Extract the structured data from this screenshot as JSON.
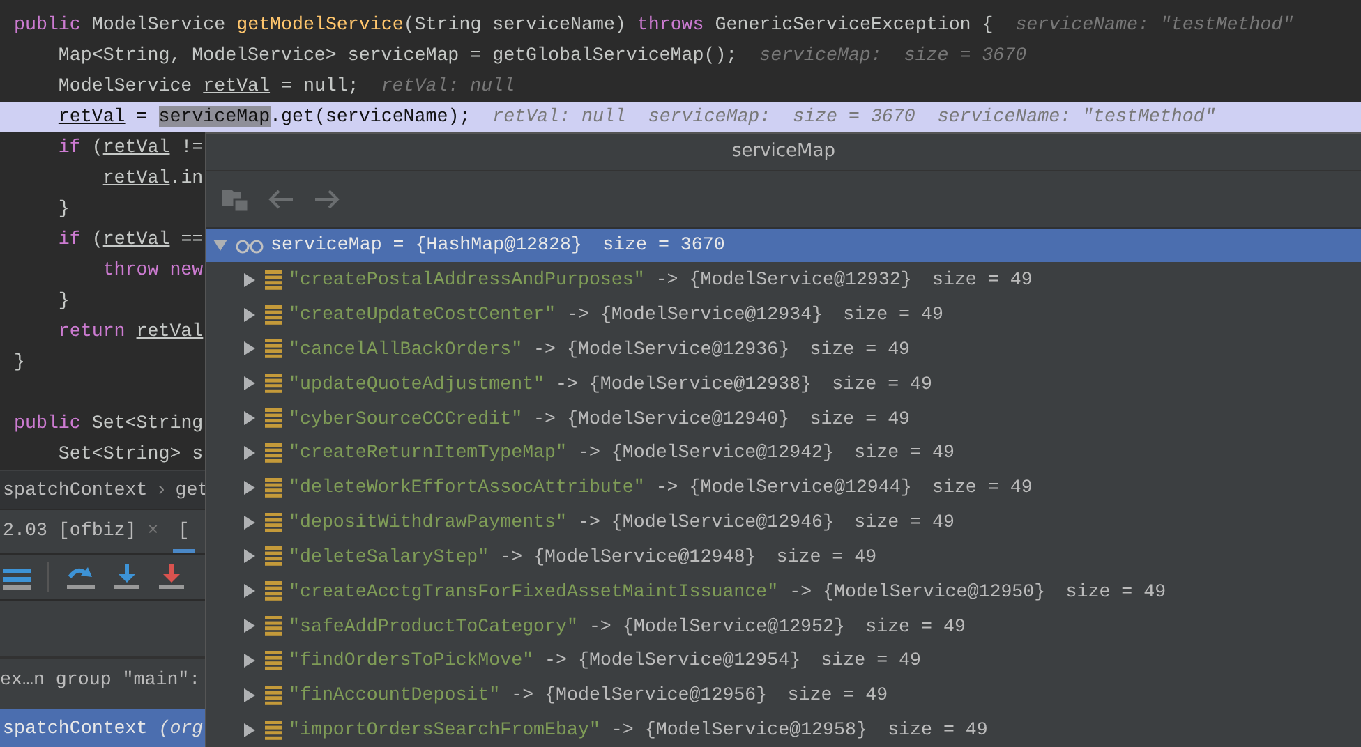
{
  "editor": {
    "lines": [
      {
        "kind": "code",
        "current": false,
        "tokens": [
          {
            "text": "public",
            "kind": "keyword"
          },
          {
            "text": " ModelService ",
            "kind": "plain"
          },
          {
            "text": "getModelService",
            "kind": "method"
          },
          {
            "text": "(String serviceName) ",
            "kind": "plain"
          },
          {
            "text": "throws",
            "kind": "keyword"
          },
          {
            "text": " GenericServiceException {",
            "kind": "plain"
          }
        ],
        "hint": "serviceName: \"testMethod\"",
        "children": [
          {
            "kind": "code",
            "current": false,
            "tokens": [
              {
                "text": "Map<String, ModelService> serviceMap = getGlobalServiceMap();",
                "kind": "plain"
              }
            ],
            "hint": "serviceMap:  size = 3670"
          },
          {
            "kind": "code",
            "current": false,
            "tokens": [
              {
                "text": "ModelService ",
                "kind": "plain"
              },
              {
                "text": "retVal",
                "kind": "variable"
              },
              {
                "text": " = null;",
                "kind": "plain"
              }
            ],
            "hint": "retVal: null"
          },
          {
            "kind": "code",
            "current": true,
            "tokens": [
              {
                "text": "retVal",
                "kind": "variable"
              },
              {
                "text": " = ",
                "kind": "plain"
              },
              {
                "text": "serviceMap",
                "kind": "selection"
              },
              {
                "text": ".get(serviceName);",
                "kind": "plain"
              }
            ],
            "hint": "retVal: null  serviceMap:  size = 3670  serviceName: \"testMethod\""
          },
          {
            "kind": "code",
            "current": false,
            "tokens": [
              {
                "text": "if",
                "kind": "keyword"
              },
              {
                "text": " (",
                "kind": "plain"
              },
              {
                "text": "retVal",
                "kind": "variable"
              },
              {
                "text": " !=",
                "kind": "plain"
              }
            ],
            "children": [
              {
                "kind": "code",
                "current": false,
                "tokens": [
                  {
                    "text": "retVal",
                    "kind": "variable"
                  },
                  {
                    "text": ".in",
                    "kind": "plain"
                  }
                ]
              }
            ]
          },
          {
            "kind": "code",
            "current": false,
            "tokens": [
              {
                "text": "}",
                "kind": "plain"
              }
            ]
          },
          {
            "kind": "code",
            "current": false,
            "tokens": [
              {
                "text": "if",
                "kind": "keyword"
              },
              {
                "text": " (",
                "kind": "plain"
              },
              {
                "text": "retVal",
                "kind": "variable"
              },
              {
                "text": " ==",
                "kind": "plain"
              }
            ],
            "children": [
              {
                "kind": "code",
                "current": false,
                "tokens": [
                  {
                    "text": "throw new",
                    "kind": "keyword"
                  }
                ]
              }
            ]
          },
          {
            "kind": "code",
            "current": false,
            "tokens": [
              {
                "text": "}",
                "kind": "plain"
              }
            ]
          },
          {
            "kind": "code",
            "current": false,
            "tokens": [
              {
                "text": "return ",
                "kind": "keyword"
              },
              {
                "text": "retVal",
                "kind": "variable"
              }
            ]
          }
        ]
      },
      {
        "kind": "code",
        "current": false,
        "tokens": [
          {
            "text": "}",
            "kind": "plain"
          }
        ]
      },
      {
        "kind": "blank"
      },
      {
        "kind": "code",
        "current": false,
        "tokens": [
          {
            "text": "public",
            "kind": "keyword"
          },
          {
            "text": " Set<String",
            "kind": "plain"
          }
        ],
        "children": [
          {
            "kind": "code",
            "current": false,
            "tokens": [
              {
                "text": "Set<String> s",
                "kind": "plain"
              }
            ]
          }
        ]
      }
    ]
  },
  "breadcrumb": {
    "items": [
      "spatchContext",
      "get"
    ],
    "separator": "›"
  },
  "debug_tabs": [
    {
      "label": "2.03 [ofbiz]",
      "close": "×",
      "selected": false
    },
    {
      "label": "[",
      "selected": true
    }
  ],
  "debug_toolbar": [
    {
      "kind": "frames"
    },
    {
      "kind": "step_over"
    },
    {
      "kind": "step_into"
    },
    {
      "kind": "force_step_into"
    }
  ],
  "thread": "ex…n group \"main\":",
  "frames": [
    {
      "method": "spatchContext",
      "location": "(org",
      "selected": true
    }
  ],
  "popup": {
    "title": "serviceMap",
    "tree": {
      "name": "serviceMap",
      "relation": "=",
      "value": "{HashMap@12828}",
      "size": "size = 3670",
      "expanded": true,
      "selected": true,
      "children": [
        {
          "name": "\"createPostalAddressAndPurposes\"",
          "relation": "->",
          "value": "{ModelService@12932}",
          "size": "size = 49",
          "expanded": false,
          "selected": false
        },
        {
          "name": "\"createUpdateCostCenter\"",
          "relation": "->",
          "value": "{ModelService@12934}",
          "size": "size = 49",
          "expanded": false,
          "selected": false
        },
        {
          "name": "\"cancelAllBackOrders\"",
          "relation": "->",
          "value": "{ModelService@12936}",
          "size": "size = 49",
          "expanded": false,
          "selected": false
        },
        {
          "name": "\"updateQuoteAdjustment\"",
          "relation": "->",
          "value": "{ModelService@12938}",
          "size": "size = 49",
          "expanded": false,
          "selected": false
        },
        {
          "name": "\"cyberSourceCCCredit\"",
          "relation": "->",
          "value": "{ModelService@12940}",
          "size": "size = 49",
          "expanded": false,
          "selected": false
        },
        {
          "name": "\"createReturnItemTypeMap\"",
          "relation": "->",
          "value": "{ModelService@12942}",
          "size": "size = 49",
          "expanded": false,
          "selected": false
        },
        {
          "name": "\"deleteWorkEffortAssocAttribute\"",
          "relation": "->",
          "value": "{ModelService@12944}",
          "size": "size = 49",
          "expanded": false,
          "selected": false
        },
        {
          "name": "\"depositWithdrawPayments\"",
          "relation": "->",
          "value": "{ModelService@12946}",
          "size": "size = 49",
          "expanded": false,
          "selected": false
        },
        {
          "name": "\"deleteSalaryStep\"",
          "relation": "->",
          "value": "{ModelService@12948}",
          "size": "size = 49",
          "expanded": false,
          "selected": false
        },
        {
          "name": "\"createAcctgTransForFixedAssetMaintIssuance\"",
          "relation": "->",
          "value": "{ModelService@12950}",
          "size": "size = 49",
          "expanded": false,
          "selected": false
        },
        {
          "name": "\"safeAddProductToCategory\"",
          "relation": "->",
          "value": "{ModelService@12952}",
          "size": "size = 49",
          "expanded": false,
          "selected": false
        },
        {
          "name": "\"findOrdersToPickMove\"",
          "relation": "->",
          "value": "{ModelService@12954}",
          "size": "size = 49",
          "expanded": false,
          "selected": false
        },
        {
          "name": "\"finAccountDeposit\"",
          "relation": "->",
          "value": "{ModelService@12956}",
          "size": "size = 49",
          "expanded": false,
          "selected": false
        },
        {
          "name": "\"importOrdersSearchFromEbay\"",
          "relation": "->",
          "value": "{ModelService@12958}",
          "size": "size = 49",
          "expanded": false,
          "selected": false
        }
      ]
    }
  }
}
